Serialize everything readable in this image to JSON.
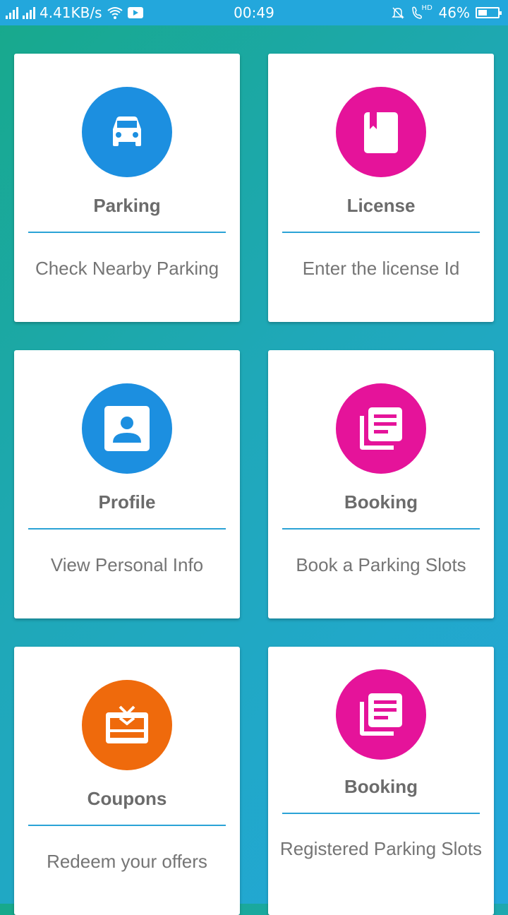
{
  "status_bar": {
    "network_speed": "4.41KB/s",
    "time": "00:49",
    "hd": "HD",
    "battery": "46%",
    "battery_level": 0.46
  },
  "cards": [
    {
      "title": "Parking",
      "description": "Check Nearby Parking",
      "icon": "car-icon",
      "color": "#1c8fe0"
    },
    {
      "title": "License",
      "description": "Enter the license Id",
      "icon": "book-icon",
      "color": "#e5139a"
    },
    {
      "title": "Profile",
      "description": "View Personal Info",
      "icon": "account-box-icon",
      "color": "#1c8fe0"
    },
    {
      "title": "Booking",
      "description": "Book a Parking Slots",
      "icon": "library-books-icon",
      "color": "#e5139a"
    },
    {
      "title": "Coupons",
      "description": "Redeem your offers",
      "icon": "gift-card-icon",
      "color": "#ef6a0c"
    },
    {
      "title": "Booking",
      "description": "Registered Parking Slots",
      "icon": "library-books-icon",
      "color": "#e5139a"
    }
  ]
}
